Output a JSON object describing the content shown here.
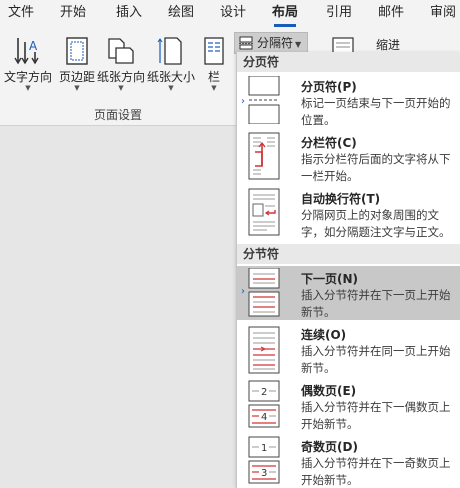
{
  "tabs": [
    {
      "label": "文件",
      "active": false
    },
    {
      "label": "开始",
      "active": false
    },
    {
      "label": "插入",
      "active": false
    },
    {
      "label": "绘图",
      "active": false
    },
    {
      "label": "设计",
      "active": false
    },
    {
      "label": "布局",
      "active": true
    },
    {
      "label": "引用",
      "active": false
    },
    {
      "label": "邮件",
      "active": false
    },
    {
      "label": "审阅",
      "active": false
    }
  ],
  "ribbon": {
    "text_direction": "文字方向",
    "margins": "页边距",
    "orientation": "纸张方向",
    "size": "纸张大小",
    "columns": "栏",
    "group_label": "页面设置",
    "breaks": "分隔符",
    "indent": "缩进"
  },
  "menu": {
    "page_breaks_header": "分页符",
    "section_breaks_header": "分节符",
    "items": [
      {
        "title": "分页符(P)",
        "desc": "标记一页结束与下一页开始的位置。",
        "icon": "page-break-icon",
        "selected": false
      },
      {
        "title": "分栏符(C)",
        "desc": "指示分栏符后面的文字将从下一栏开始。",
        "icon": "column-break-icon",
        "selected": false
      },
      {
        "title": "自动换行符(T)",
        "desc": "分隔网页上的对象周围的文字，如分隔题注文字与正文。",
        "icon": "text-wrapping-break-icon",
        "selected": false
      },
      {
        "title": "下一页(N)",
        "desc": "插入分节符并在下一页上开始新节。",
        "icon": "next-page-break-icon",
        "selected": true
      },
      {
        "title": "连续(O)",
        "desc": "插入分节符并在同一页上开始新节。",
        "icon": "continuous-break-icon",
        "selected": false
      },
      {
        "title": "偶数页(E)",
        "desc": "插入分节符并在下一偶数页上开始新节。",
        "icon": "even-page-break-icon",
        "selected": false
      },
      {
        "title": "奇数页(D)",
        "desc": "插入分节符并在下一奇数页上开始新节。",
        "icon": "odd-page-break-icon",
        "selected": false
      }
    ]
  },
  "colors": {
    "accent": "#185abd",
    "red_mark": "#d13438",
    "selected_bg": "#c8c8c8"
  }
}
